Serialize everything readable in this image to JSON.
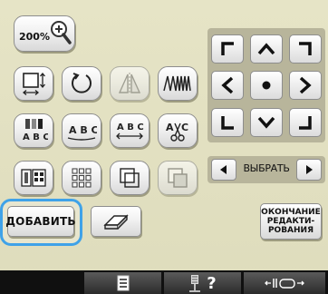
{
  "zoom": {
    "label": "200%"
  },
  "actions": {
    "add_label": "ДОБАВИТЬ",
    "finish_line1": "ОКОНЧАНИЕ",
    "finish_line2": "РЕДАКТИ-",
    "finish_line3": "РОВАНИЯ"
  },
  "selector": {
    "label": "ВЫБРАТЬ"
  },
  "edit_icons": {
    "abc1": "A B C",
    "abc_top": "A B C",
    "abc_arc": "A B C",
    "abc_scissor": "A"
  },
  "status": {
    "help_label": "?"
  },
  "colors": {
    "screen_bg": "#e2e0c2",
    "accent_highlight": "#3fa2e8",
    "pad_bg": "#b8b59b",
    "status_bar": "#101010"
  },
  "icons": [
    "zoom-magnifier-icon",
    "size-icon",
    "rotate-icon",
    "mirror-icon",
    "density-icon",
    "color-change-icon",
    "arc-text-icon",
    "char-spacing-icon",
    "stitch-cut-icon",
    "multicolor-icon",
    "array-icon",
    "border-icon",
    "outline-icon",
    "delete-icon",
    "thread-chart-icon",
    "needle-help-icon",
    "presser-foot-icon"
  ]
}
